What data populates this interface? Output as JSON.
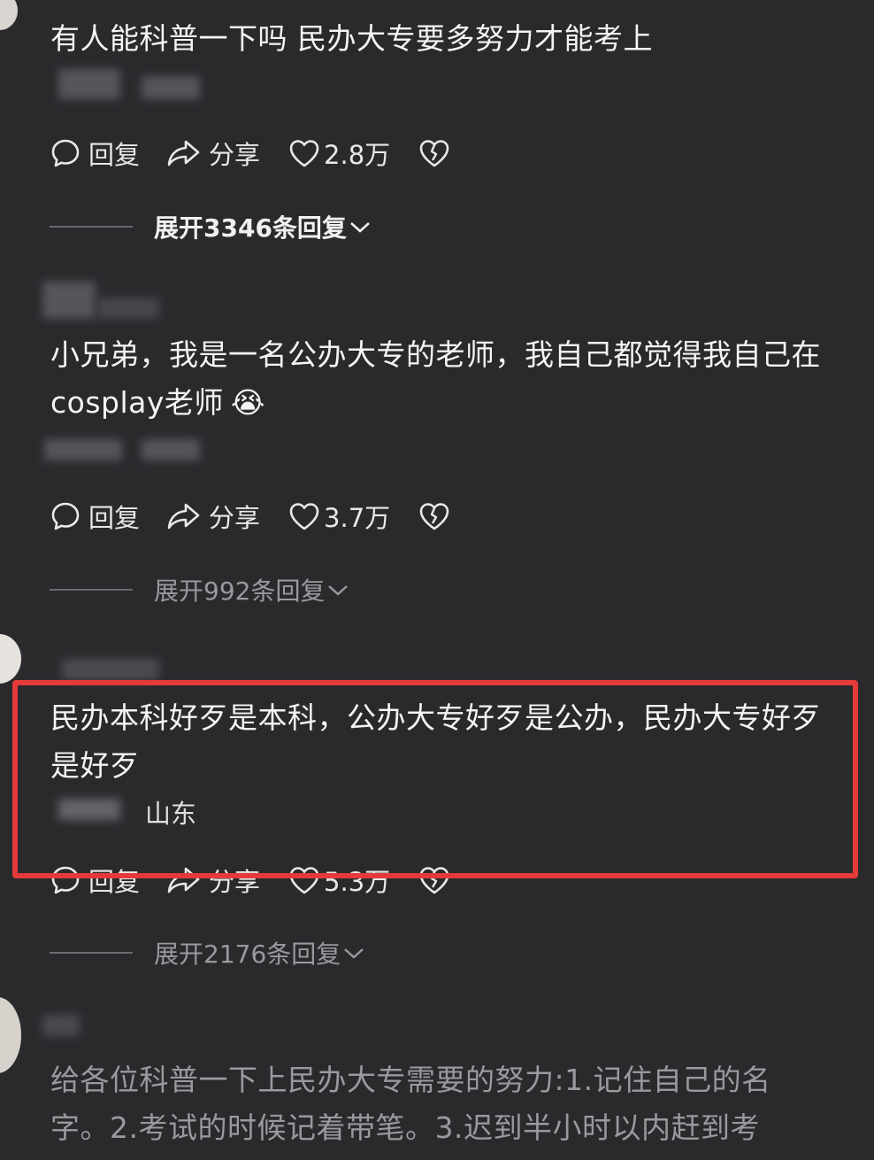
{
  "comments": [
    {
      "text": "有人能科普一下吗  民办大专要多努力才能考上",
      "actions": {
        "reply": "回复",
        "share": "分享",
        "likes": "2.8万"
      },
      "expand_replies": "展开3346条回复"
    },
    {
      "text": "小兄弟，我是一名公办大专的老师，我自己都觉得我自己在cosplay老师",
      "emoji": "😭",
      "actions": {
        "reply": "回复",
        "share": "分享",
        "likes": "3.7万"
      },
      "expand_replies": "展开992条回复"
    },
    {
      "text": "民办本科好歹是本科，公办大专好歹是公办，民办大专好歹是好歹",
      "location": "山东",
      "actions": {
        "reply": "回复",
        "share": "分享",
        "likes": "5.3万"
      },
      "expand_replies": "展开2176条回复"
    },
    {
      "text": "给各位科普一下上民办大专需要的努力:1.记住自己的名字。2.考试的时候记着带笔。3.迟到半小时以内赶到考"
    }
  ],
  "colors": {
    "background": "#2a2a2d",
    "highlight_border": "#e43a3a"
  },
  "icons": [
    "comment-bubble-icon",
    "share-arrow-icon",
    "heart-icon",
    "broken-heart-icon",
    "chevron-down-icon"
  ]
}
